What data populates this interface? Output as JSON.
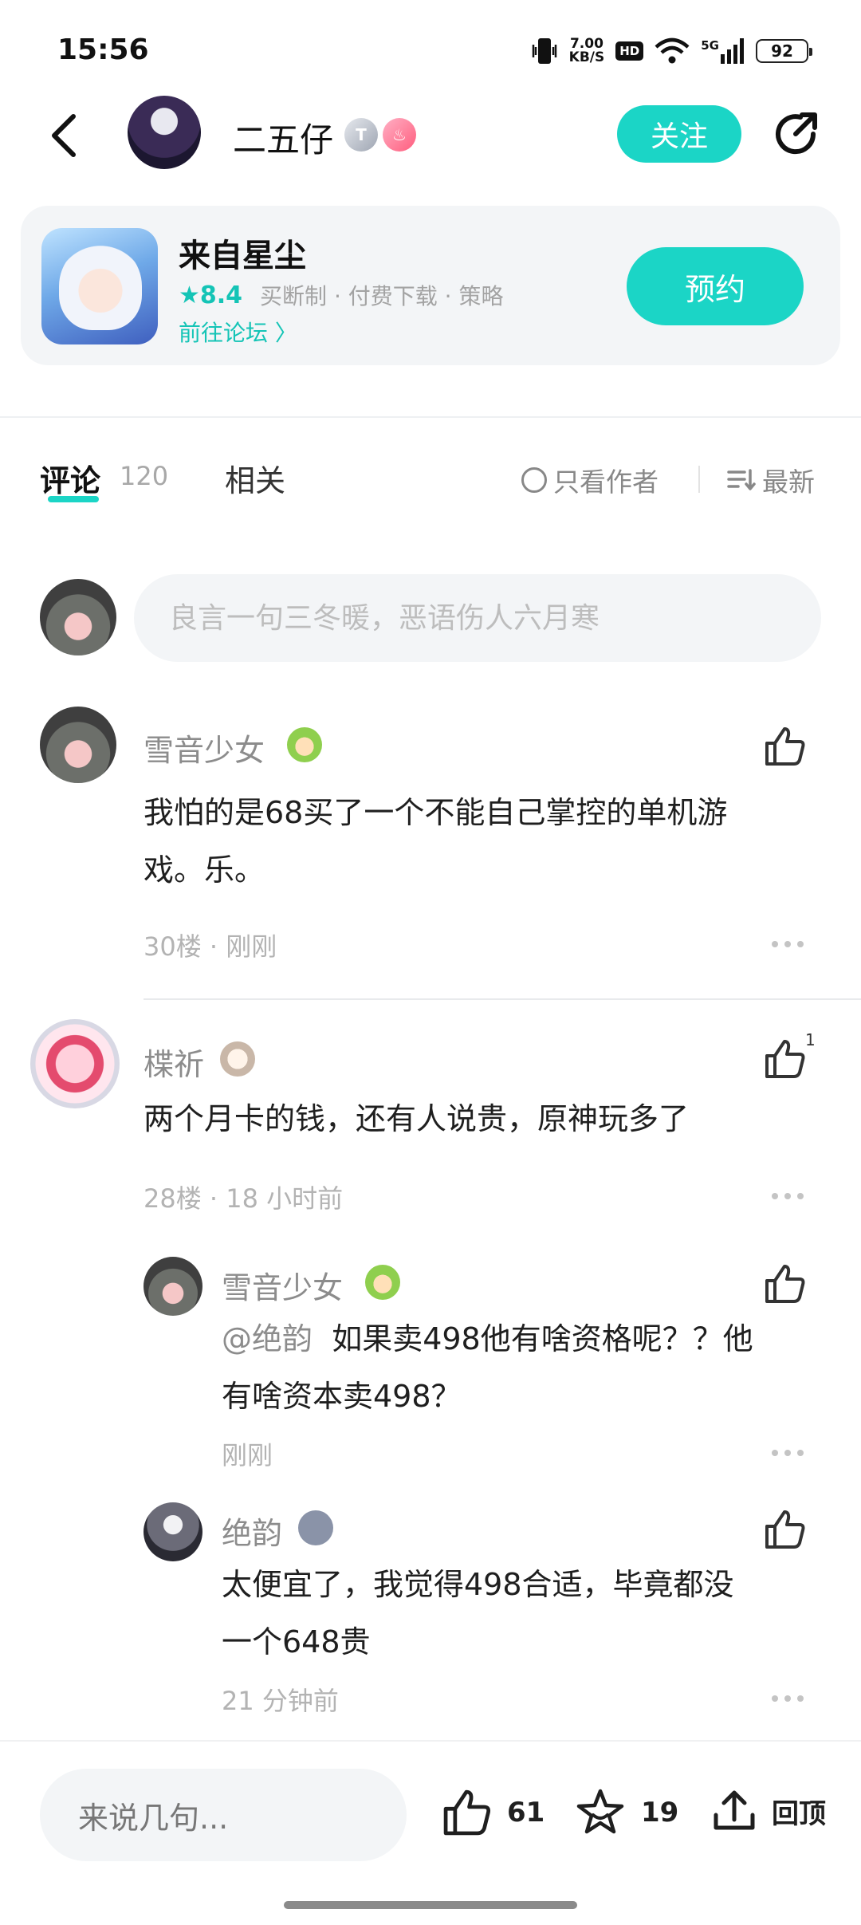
{
  "status_bar": {
    "time": "15:56",
    "net_speed_value": "7.00",
    "net_speed_unit": "KB/S",
    "hd": "HD",
    "signal": "5G",
    "battery": "92"
  },
  "header": {
    "author_name": "二五仔",
    "badge_t": "T",
    "follow_label": "关注"
  },
  "game_card": {
    "title": "来自星尘",
    "rating": "★8.4",
    "tags": "买断制 · 付费下载 · 策略",
    "forum_link": "前往论坛 〉",
    "reserve_label": "预约"
  },
  "tabs": {
    "comments_label": "评论",
    "comments_count": "120",
    "related_label": "相关",
    "author_only_label": "只看作者",
    "sort_label": "最新"
  },
  "comment_input": {
    "placeholder": "良言一句三冬暖，恶语伤人六月寒"
  },
  "comments": [
    {
      "author": "雪音少女",
      "text_line1": "我怕的是68买了一个不能自己掌控的单机游",
      "text_line2": "戏。乐。",
      "meta": "30楼 · 刚刚"
    },
    {
      "author": "楪祈",
      "text_line1": "两个月卡的钱，还有人说贵，原神玩多了",
      "meta": "28楼 · 18 小时前",
      "like_count": "1",
      "replies": [
        {
          "author": "雪音少女",
          "mention": "@绝韵",
          "text_line1": "如果卖498他有啥资格呢？？他",
          "text_line2": "有啥资本卖498？",
          "meta": "刚刚"
        },
        {
          "author": "绝韵",
          "text_line1": "太便宜了，我觉得498合适，毕竟都没",
          "text_line2": "一个648贵",
          "meta": "21 分钟前"
        }
      ]
    }
  ],
  "bottom_bar": {
    "input_placeholder": "来说几句...",
    "like_count": "61",
    "favorite_count": "19",
    "top_label": "回顶"
  },
  "colors": {
    "accent": "#1bd5c6",
    "text_primary": "#1f1f1f",
    "text_secondary": "#8c8c8c",
    "card_bg": "#f3f5f7"
  }
}
